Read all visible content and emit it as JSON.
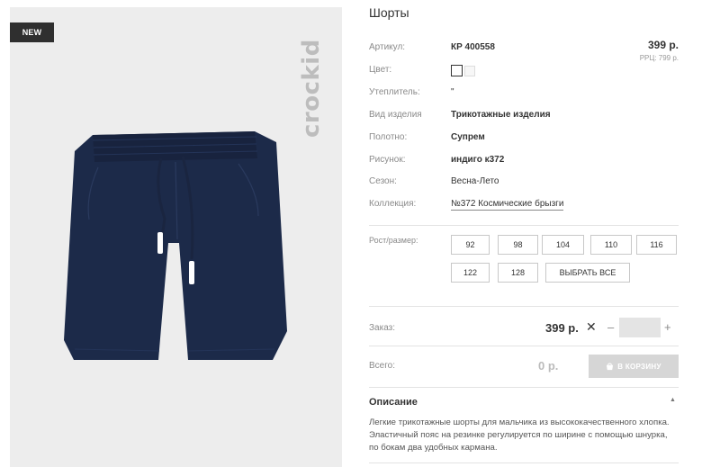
{
  "product": {
    "badge": "NEW",
    "brand": "crockid",
    "title": "Шорты",
    "price": "399 р.",
    "rrp": "РРЦ: 799 р."
  },
  "attributes": {
    "article": {
      "label": "Артикул:",
      "value": "КР 400558"
    },
    "color": {
      "label": "Цвет:"
    },
    "insulation": {
      "label": "Утеплитель:",
      "value": "\""
    },
    "type": {
      "label": "Вид изделия",
      "value": "Трикотажные изделия"
    },
    "fabric": {
      "label": "Полотно:",
      "value": "Супрем"
    },
    "pattern": {
      "label": "Рисунок:",
      "value": "индиго к372"
    },
    "season": {
      "label": "Сезон:",
      "value": "Весна-Лето"
    },
    "collection": {
      "label": "Коллекция:",
      "value": "№372 Космические брызги"
    }
  },
  "sizes": {
    "label": "Рост/размер:",
    "options": [
      "92",
      "98",
      "104",
      "110",
      "116",
      "122",
      "128"
    ],
    "select_all": "ВЫБРАТЬ ВСЕ"
  },
  "order": {
    "label": "Заказ:",
    "price": "399 р.",
    "remove": "✕",
    "minus": "–",
    "plus": "+",
    "quantity": ""
  },
  "total": {
    "label": "Всего:",
    "value": "0 р.",
    "cart_button": "В КОРЗИНУ"
  },
  "description": {
    "title": "Описание",
    "toggle": "▲",
    "text": "Легкие трикотажные шорты для мальчика из высококачественного хлопка. Эластичный пояс на резинке регулируется по ширине с помощью шнурка, по бокам два удобных кармана."
  }
}
